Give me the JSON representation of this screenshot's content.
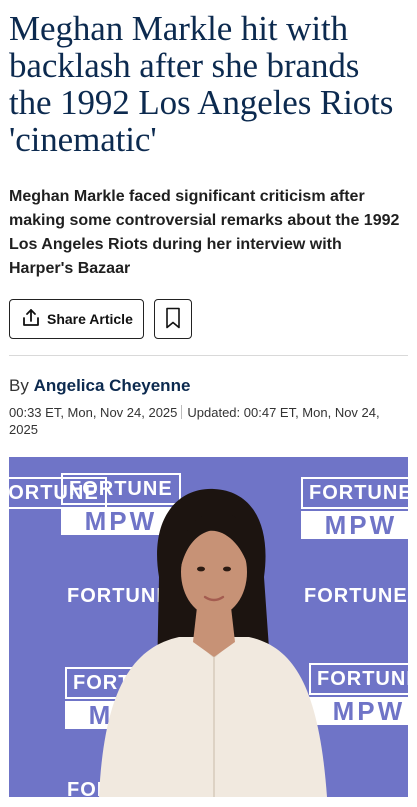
{
  "article": {
    "headline": "Meghan Markle hit with backlash after she brands the 1992 Los Angeles Riots 'cinematic'",
    "standfirst": "Meghan Markle faced significant criticism after making some controversial remarks about the 1992 Los Angeles Riots during her interview with Harper's Bazaar",
    "share_label": "Share Article",
    "byline_prefix": "By",
    "author": "Angelica Cheyenne",
    "published": "00:33 ET, Mon, Nov 24, 2025",
    "updated": "Updated: 00:47 ET, Mon, Nov 24, 2025"
  },
  "photo": {
    "backdrop_logo_top": "FORTUNE",
    "backdrop_logo_bottom": "MPW",
    "backdrop_color": "#6f74c7",
    "blouse_color": "#f1e9df",
    "hair_color": "#1c1410",
    "skin_color": "#c79276"
  },
  "colors": {
    "headline": "#0c2a4f",
    "author": "#0c2a4f"
  },
  "icons": {
    "share": "share-icon",
    "bookmark": "bookmark-icon"
  }
}
